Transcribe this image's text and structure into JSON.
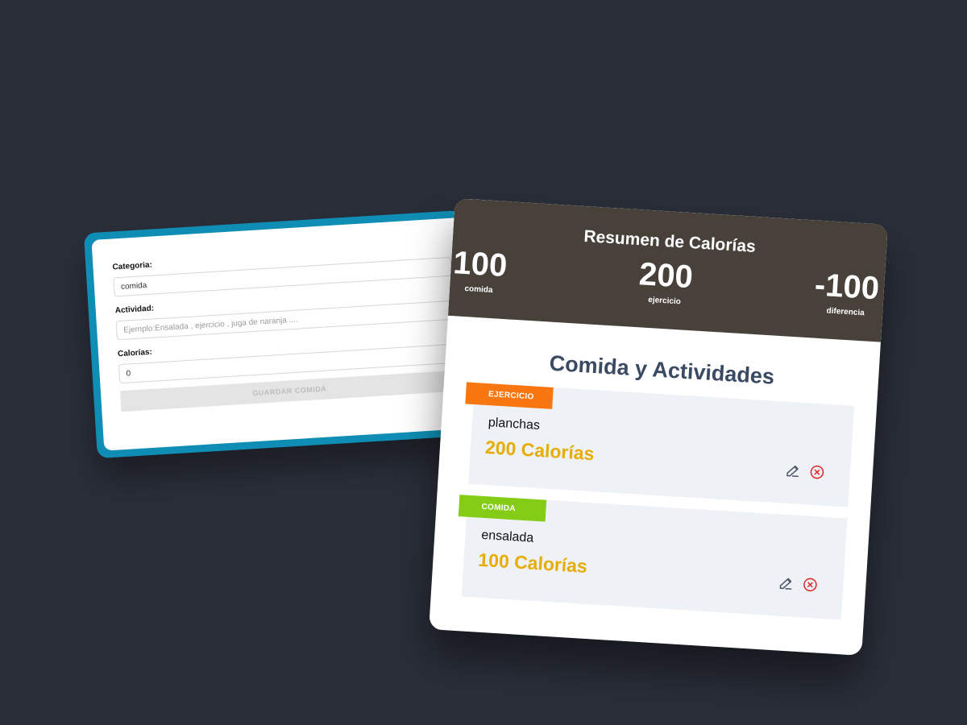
{
  "form": {
    "category_label": "Categoria:",
    "category_value": "comida",
    "activity_label": "Actividad:",
    "activity_placeholder": "Ejemplo:Ensalada , ejercicio , juga de naranja ....",
    "calories_label": "Calorías:",
    "calories_value": "0",
    "save_label": "GUARDAR COMIDA"
  },
  "summary": {
    "title": "Resumen de Calorías",
    "stats": [
      {
        "value": "100",
        "label": "comida"
      },
      {
        "value": "200",
        "label": "ejercicio"
      },
      {
        "value": "-100",
        "label": "diferencia"
      }
    ]
  },
  "list": {
    "title": "Comida y Actividades",
    "items": [
      {
        "tag": "EJERCICIO",
        "tag_color": "#f7760f",
        "name": "planchas",
        "calories": "200 Calorías"
      },
      {
        "tag": "COMIDA",
        "tag_color": "#84cc16",
        "name": "ensalada",
        "calories": "100 Calorías"
      }
    ]
  },
  "colors": {
    "background": "#2a2e39",
    "form_border": "#108db4",
    "header_bg": "#47413a",
    "calories_text": "#e6ad06",
    "delete_icon": "#dc2626"
  },
  "icons": {
    "edit": "edit-icon",
    "delete": "delete-circle-icon"
  }
}
